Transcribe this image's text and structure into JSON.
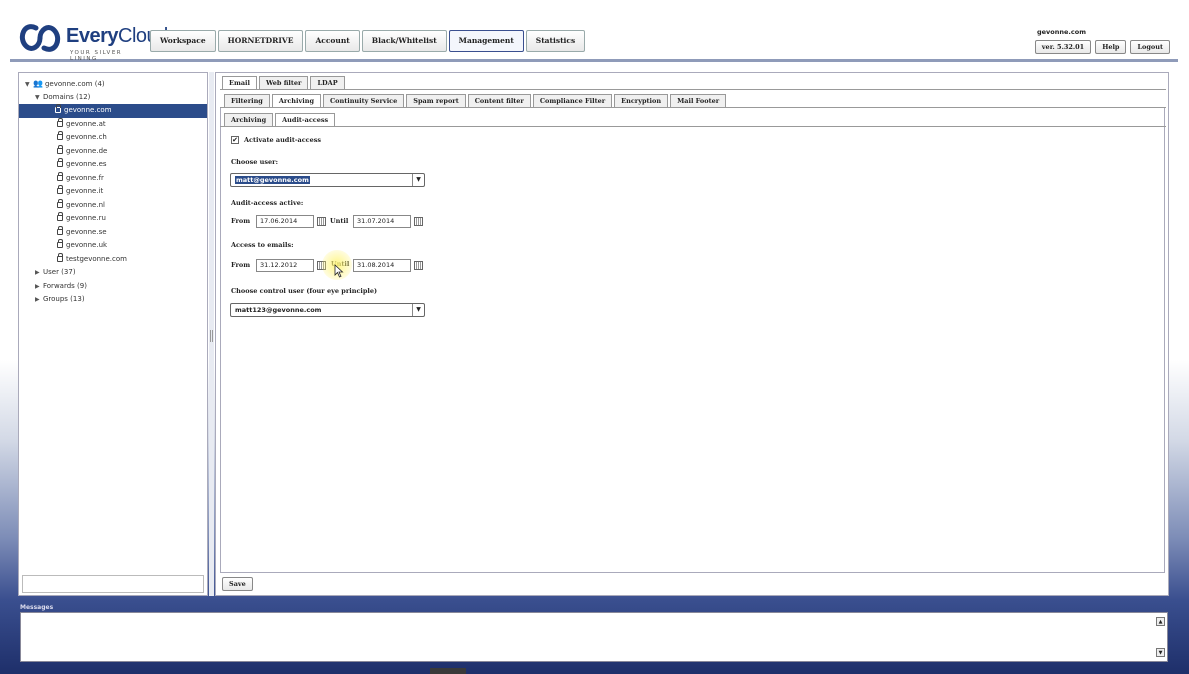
{
  "header": {
    "brand_main": "Every",
    "brand_thin": "Cloud",
    "tagline": "YOUR SILVER LINING",
    "nav": [
      "Workspace",
      "HORNETDRIVE",
      "Account",
      "Black/Whitelist",
      "Management",
      "Statistics"
    ],
    "active_nav": "Management",
    "account_domain": "gevonne.com",
    "version": "ver. 5.32.01",
    "help": "Help",
    "logout": "Logout"
  },
  "tree": {
    "root": "gevonne.com (4)",
    "domains_label": "Domains (12)",
    "selected_domain": "gevonne.com",
    "domains": [
      "gevonne.at",
      "gevonne.ch",
      "gevonne.de",
      "gevonne.es",
      "gevonne.fr",
      "gevonne.it",
      "gevonne.nl",
      "gevonne.ru",
      "gevonne.se",
      "gevonne.uk",
      "testgevonne.com"
    ],
    "user": "User (37)",
    "forwards": "Forwards (9)",
    "groups": "Groups (13)"
  },
  "tabs_level1": [
    "Email",
    "Web filter",
    "LDAP"
  ],
  "tabs_level2": [
    "Filtering",
    "Archiving",
    "Continuity Service",
    "Spam report",
    "Content filter",
    "Compliance Filter",
    "Encryption",
    "Mail Footer"
  ],
  "tabs_level3": [
    "Archiving",
    "Audit-access"
  ],
  "form": {
    "activate_label": "Activate audit-access",
    "activate_checked_mark": "✔",
    "choose_user_label": "Choose user:",
    "choose_user_value": "matt@gevonne.com",
    "audit_active_label": "Audit-access active:",
    "from_label": "From",
    "until_label": "Until",
    "audit_from": "17.06.2014",
    "audit_until": "31.07.2014",
    "access_emails_label": "Access to emails:",
    "emails_from": "31.12.2012",
    "emails_until": "31.08.2014",
    "control_user_label": "Choose control user (four eye principle)",
    "control_user_value": "matt123@gevonne.com",
    "save": "Save"
  },
  "messages": {
    "title": "Messages"
  }
}
